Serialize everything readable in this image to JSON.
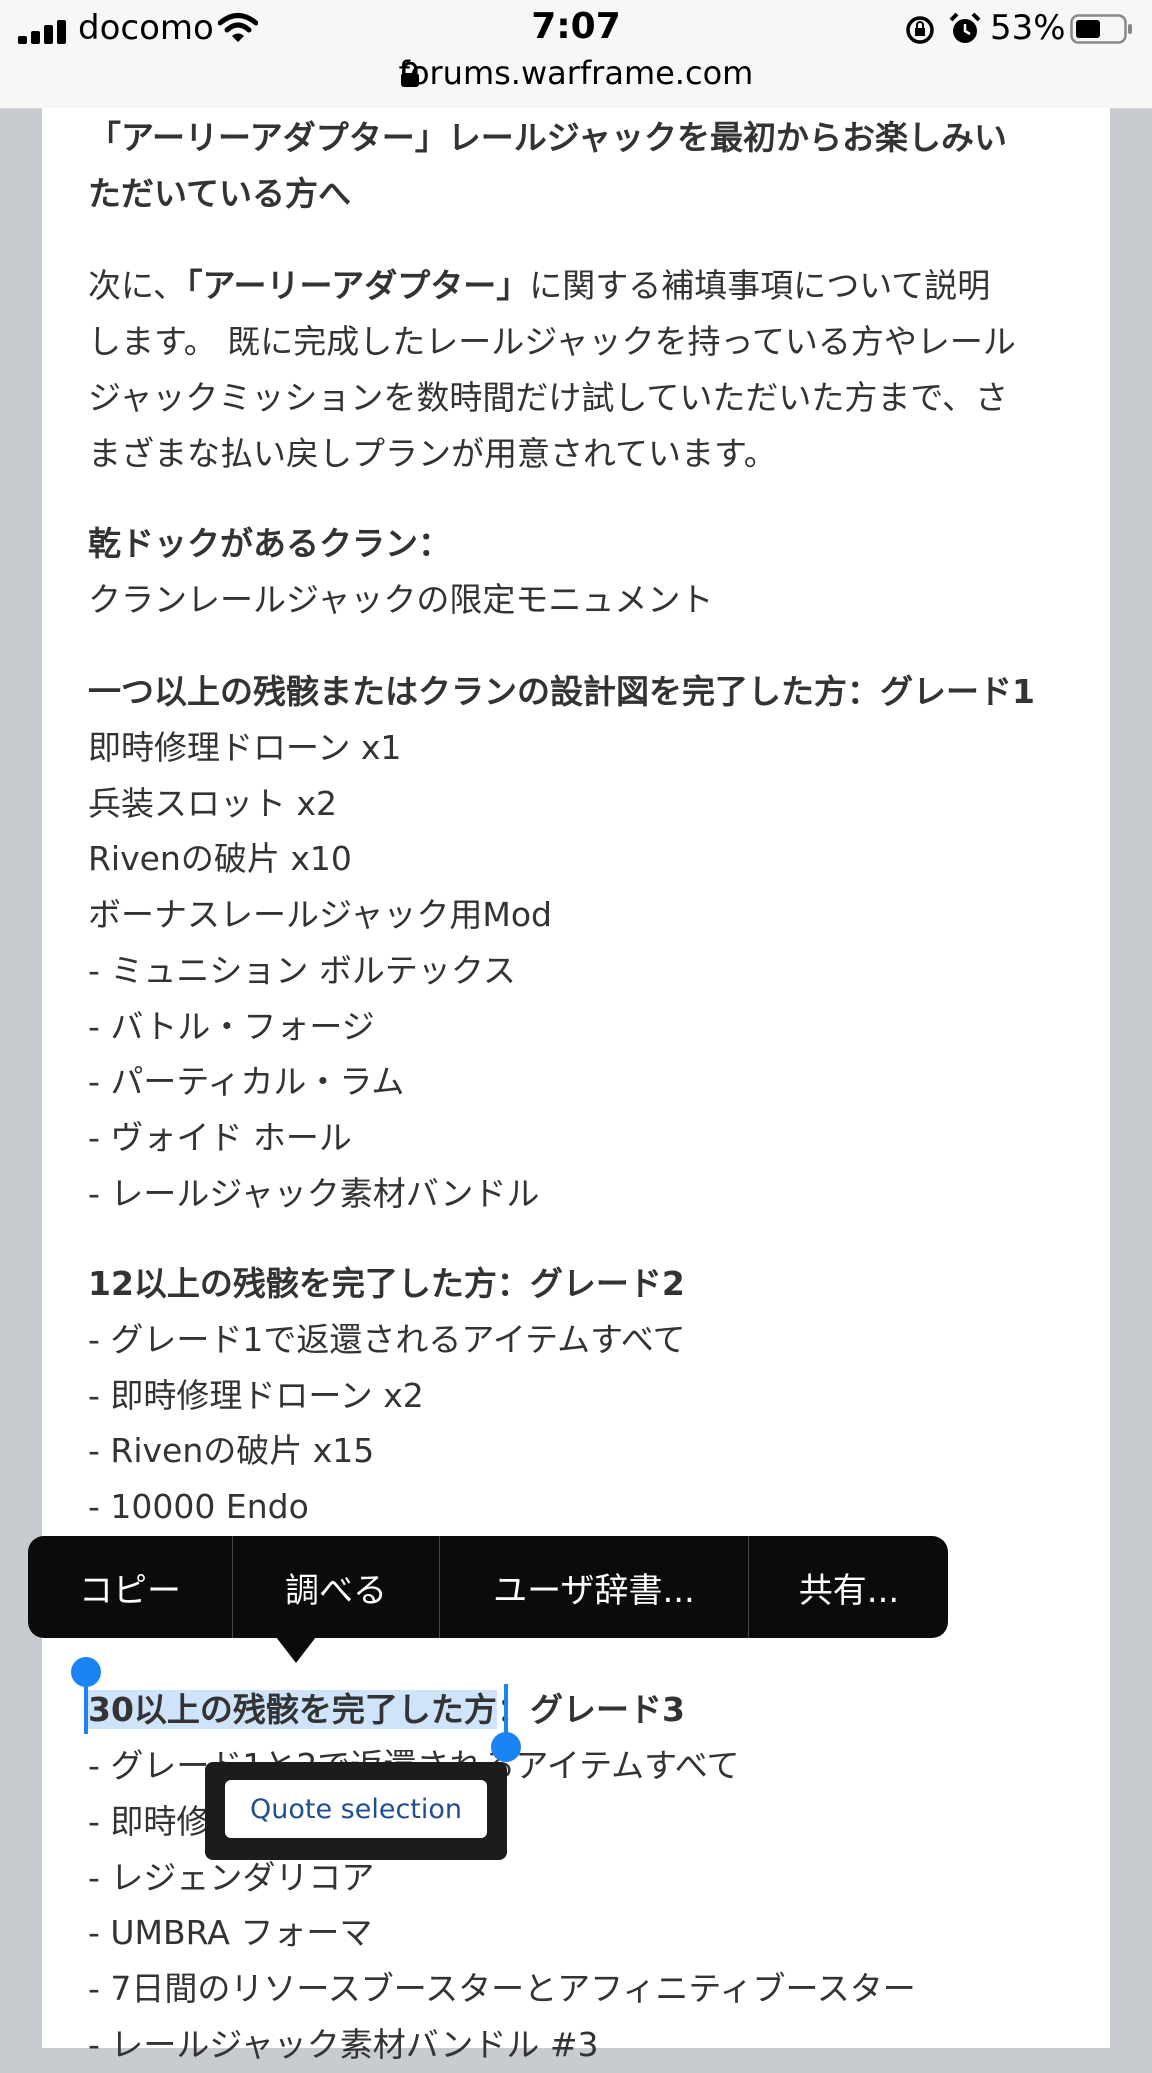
{
  "status_bar": {
    "carrier": "docomo",
    "time": "7:07",
    "battery_percent": "53%",
    "url": "forums.warframe.com",
    "icons": [
      "signal-icon",
      "wifi-icon",
      "rotation-lock-icon",
      "alarm-icon",
      "battery-icon",
      "lock-icon"
    ]
  },
  "article": {
    "heading_line1": "「アーリーアダプター」レールジャックを最初からお楽しみい",
    "heading_line2": "ただいている方へ",
    "intro_pre": "次に、",
    "intro_bold": "「アーリーアダプター」",
    "intro_post": "に関する補填事項について説明",
    "intro_line2": "します。 既に完成したレールジャックを持っている方やレール",
    "intro_line3": "ジャックミッションを数時間だけ試していただいた方まで、さ",
    "intro_line4": "まざまな払い戻しプランが用意されています。",
    "drydock_title": "乾ドックがあるクラン：",
    "drydock_item": "クランレールジャックの限定モニュメント",
    "grade1_title": "一つ以上の残骸またはクランの設計図を完了した方：グレード1",
    "grade1_items": [
      "即時修理ドローン x1",
      "兵装スロット x2",
      "Rivenの破片 x10",
      "ボーナスレールジャック用Mod",
      "- ミュニション ボルテックス",
      "- バトル・フォージ",
      "- パーティカル・ラム",
      "- ヴォイド ホール",
      "- レールジャック素材バンドル"
    ],
    "grade2_title": "12以上の残骸を完了した方：グレード2",
    "grade2_items": [
      "- グレード1で返還されるアイテムすべて",
      "- 即時修理ドローン x2",
      "- Rivenの破片 x15",
      "- 10000 Endo"
    ],
    "grade3_title_selected": "30以上の残骸を完了した方",
    "grade3_title_rest": "：グレード3",
    "grade3_items": [
      "- グレード1と2で返還されるアイテムすべて",
      "- 即時修",
      "- レジェンダリコア",
      "- UMBRA フォーマ",
      "- 7日間のリソースブースターとアフィニティブースター",
      "- レールジャック素材バンドル #3"
    ]
  },
  "context_menu": {
    "items": [
      "コピー",
      "調べる",
      "ユーザ辞書...",
      "共有..."
    ]
  },
  "quote_button": "Quote selection"
}
